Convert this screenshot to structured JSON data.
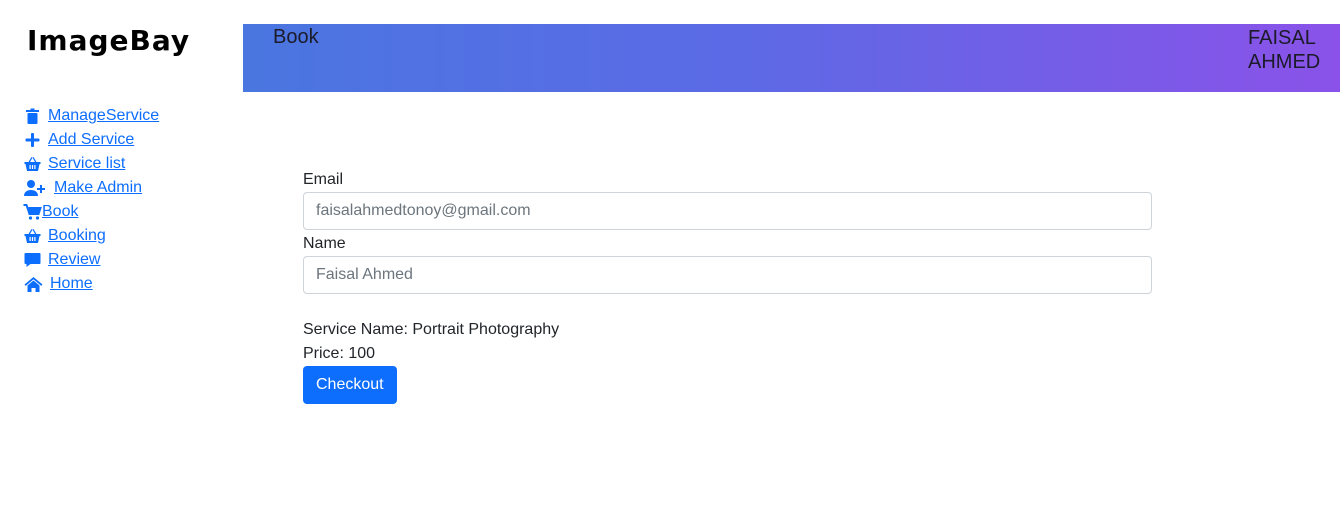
{
  "brand": {
    "logo_text": "ImageBay"
  },
  "header": {
    "title": "Book",
    "user_name": "FAISAL AHMED",
    "gradient_start": "#4a76e0",
    "gradient_end": "#8a52e8"
  },
  "sidebar": {
    "items": [
      {
        "label": "ManageService",
        "icon": "trash-icon"
      },
      {
        "label": "Add Service",
        "icon": "plus-icon"
      },
      {
        "label": "Service list",
        "icon": "basket-icon"
      },
      {
        "label": "Make Admin",
        "icon": "user-plus-icon"
      },
      {
        "label": "Book",
        "icon": "cart-icon"
      },
      {
        "label": "Booking",
        "icon": "basket-icon"
      },
      {
        "label": "Review",
        "icon": "comment-icon"
      },
      {
        "label": "Home",
        "icon": "home-icon"
      }
    ]
  },
  "form": {
    "email_label": "Email",
    "email_value": "faisalahmedtonoy@gmail.com",
    "name_label": "Name",
    "name_value": "Faisal Ahmed",
    "service_name": "Service Name: Portrait Photography",
    "price": "Price: 100",
    "checkout_label": "Checkout"
  },
  "colors": {
    "accent": "#0d6efd"
  }
}
